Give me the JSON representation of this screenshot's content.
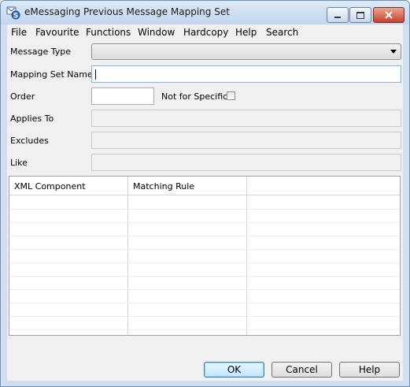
{
  "window": {
    "title": "eMessaging Previous Message Mapping Set"
  },
  "menu": [
    "File",
    "Favourite",
    "Functions",
    "Window",
    "Hardcopy",
    "Help",
    "Search"
  ],
  "form": {
    "message_type_label": "Message Type",
    "message_type_value": "",
    "mapping_set_name_label": "Mapping Set Name",
    "mapping_set_name_value": "",
    "order_label": "Order",
    "order_value": "",
    "not_for_specific_label": "Not for Specific",
    "not_for_specific_checked": false,
    "applies_to_label": "Applies To",
    "applies_to_value": "",
    "excludes_label": "Excludes",
    "excludes_value": "",
    "like_label": "Like",
    "like_value": ""
  },
  "grid": {
    "columns": [
      "XML Component",
      "Matching Rule",
      ""
    ],
    "rows": []
  },
  "buttons": {
    "ok": "OK",
    "cancel": "Cancel",
    "help": "Help"
  },
  "colors": {
    "title_bar": "#c3d6ee",
    "close_button": "#c8422e",
    "dialog_bg": "#f0f0f0",
    "default_button": "#bee6fd"
  }
}
